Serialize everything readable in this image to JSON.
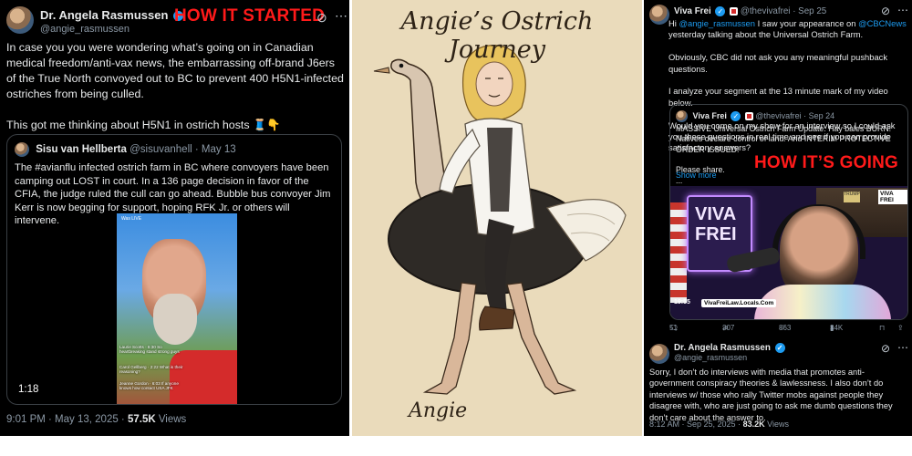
{
  "left_tweet": {
    "author_name": "Dr. Angela Rasmussen",
    "handle": "@angie_rasmussen",
    "banner": "HOW IT STARTED",
    "paragraph_1": "In case you you were wondering what’s going on in Canadian medical freedom/anti-vax news, the embarrassing off-brand J6ers of the True North convoyed out to BC to prevent 400 H5N1-infected ostriches from being culled.",
    "paragraph_2": "This got me thinking about H5N1 in ostrich hosts 🧵👇",
    "quote": {
      "author_name": "Sisu van Hellberta",
      "handle": "@sisuvanhell",
      "date": "· May 13",
      "text": "The #avianflu infected ostrich farm in BC where convoyers have been camping out LOST in court. In a 136 page decision in favor of the CFIA, the judge ruled the cull can go ahead. Bubble bus convoyer Jim Kerr is now begging for support, hoping RFK Jr. or others will intervene.",
      "video_time": "1:18",
      "video_live_label": "Was LIVE",
      "video_comments": [
        "Laurie Scotts · 6:30 So heartbreaking stand strong guys",
        "Carol Gellberg · 2:22 What is their reasoning?",
        "Jeanne Gordon · 6:03 If anyone knows how contact USA JFK"
      ]
    },
    "footer_time": "9:01 PM · May 13, 2025 · ",
    "footer_views_count": "57.5K",
    "footer_views_label": " Views"
  },
  "middle_art": {
    "title": "Angie’s Ostrich Journey",
    "signature": "Angie"
  },
  "right_tweet_top": {
    "author_name": "Viva Frei",
    "handle": "@thevivafrei · Sep 25",
    "greeting_prefix": "Hi ",
    "mention_1": "@angie_rasmussen",
    "greeting_mid": " I saw your appearance on ",
    "mention_2": "@CBCNews",
    "greeting_suffix": " yesterday talking about the Universal Ostrich Farm.",
    "paragraph_2": "Obviously, CBC did not ask you any meaningful pushback questions.",
    "paragraph_3": "I analyze your segment at the 13 minute mark of my video below.",
    "paragraph_4": "Would you come on my show for an interview so I could ask you these questions in real time and see if you can provide satisfactory answers?",
    "quote": {
      "author_name": "Viva Frei",
      "handle": "@thevivafrei · Sep 24",
      "text": "MASSIVE Universal Ostrich Farm Update: Hay bales BURN! Natives declare control of land! And INTERIM PROTECTIVE ORDER ISSUED!",
      "text_2": "Please share.",
      "ellipsis": "...",
      "show_more": "Show more",
      "banner": "HOW IT’S GOING",
      "video_time": "19:55",
      "overlay": "VivaFreiLaw.Locals.Com",
      "neon_sign": "VIVA FREI",
      "corner_logo": "VIVA FREI",
      "shelf_tag": "TRUMP"
    },
    "actions": {
      "replies": "51",
      "reposts": "307",
      "likes": "863",
      "views": "34K"
    }
  },
  "right_tweet_bottom": {
    "author_name": "Dr. Angela Rasmussen",
    "handle": "@angie_rasmussen",
    "text": "Sorry, I don’t do interviews with media that promotes anti-government conspiracy theories & lawlessness. I also don’t do interviews w/ those who rally Twitter mobs against people they disagree with, who are just going to ask me dumb questions they don’t care about the answer to.",
    "footer_time": "8:12 AM · Sep 25, 2025 · ",
    "footer_views_count": "83.2K",
    "footer_views_label": " Views"
  },
  "icons": {
    "verified": "verified-check-icon",
    "grok": "grok-icon",
    "more": "more-options-icon",
    "reply": "reply-icon",
    "repost": "repost-icon",
    "like": "like-icon",
    "views": "views-icon"
  },
  "colors": {
    "banner_red": "#ff1a1a",
    "link_blue": "#1d9bf0",
    "tweet_bg": "#000000",
    "art_bg": "#eadbbb"
  }
}
